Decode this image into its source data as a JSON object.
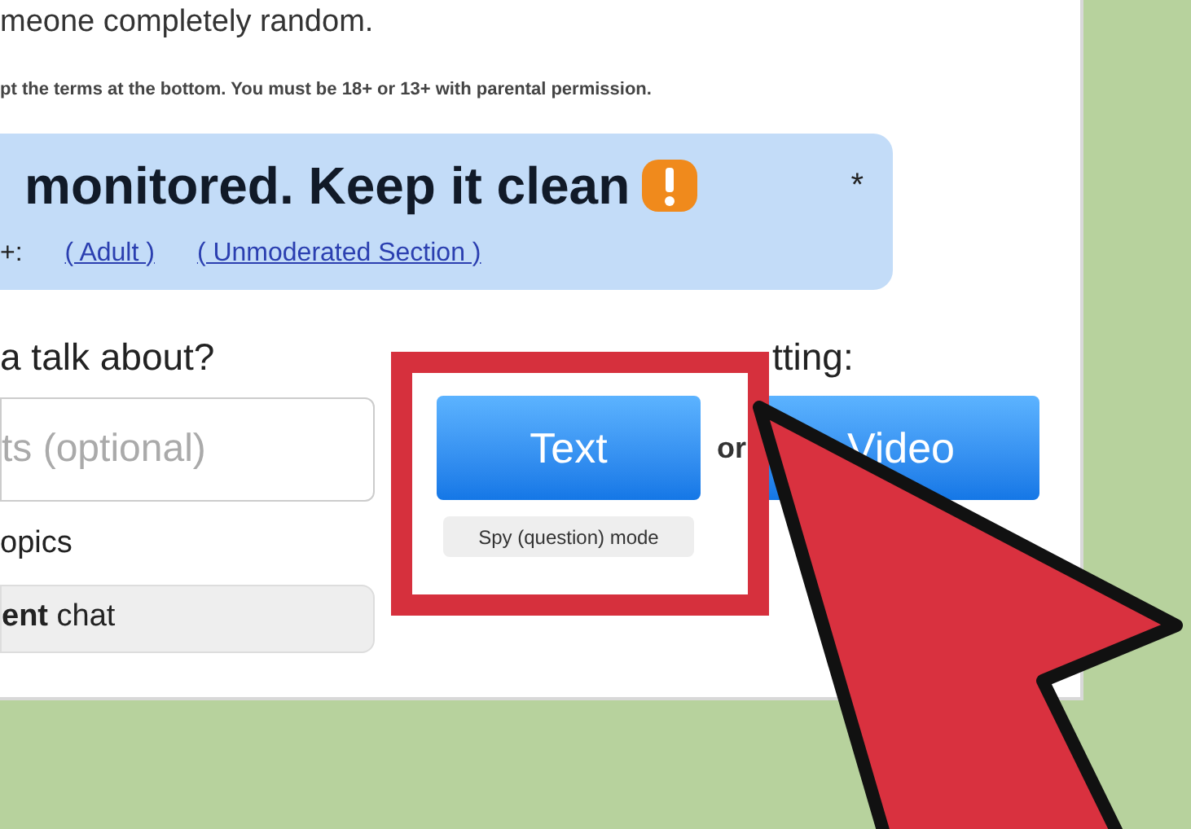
{
  "intro": "meone completely random.",
  "terms": "pt the terms at the bottom. You must be 18+ or 13+ with parental permission.",
  "banner": {
    "heading": "monitored. Keep it clean",
    "asterisk": "*",
    "prefix": "+:",
    "links": [
      "( Adult )",
      "( Unmoderated Section )"
    ]
  },
  "topics": {
    "question": "a talk about?",
    "placeholder": "ts (optional)",
    "label": "opics",
    "mode_bar": "**ent** chat"
  },
  "start": {
    "label": "tting:",
    "text_button": "Text",
    "spy_mode": "Spy (question) mode",
    "or": "or",
    "video_button": "Video"
  }
}
